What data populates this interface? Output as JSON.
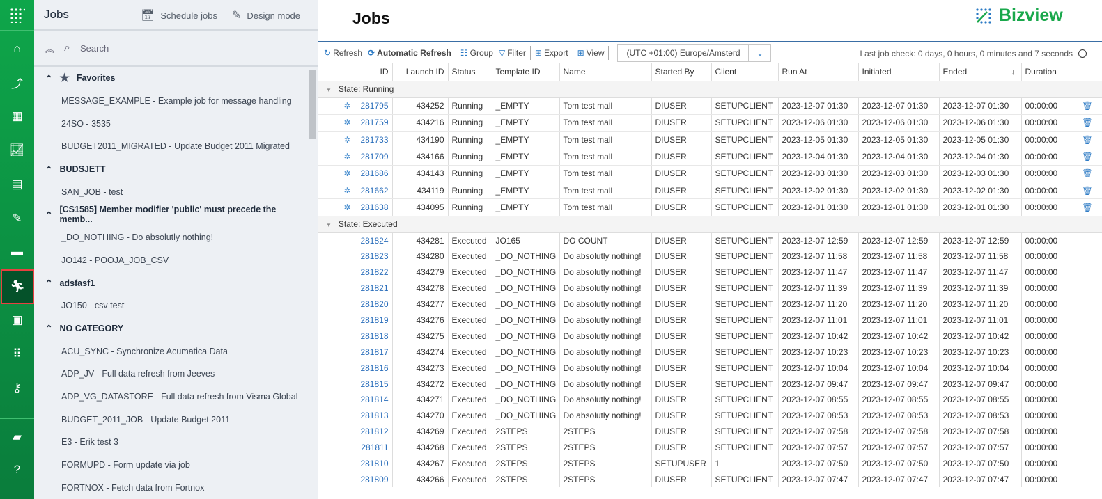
{
  "rail": {
    "items": [
      "home-icon",
      "flow-icon",
      "dashboard-icon",
      "chart-icon",
      "document-icon",
      "form-edit-icon",
      "chat-icon",
      "jobs-runner-icon",
      "contacts-icon",
      "apps-icon",
      "key-icon",
      "folder-icon",
      "help-icon"
    ],
    "active": "jobs-runner-icon"
  },
  "sidebar": {
    "title": "Jobs",
    "schedule_jobs": "Schedule jobs",
    "design_mode": "Design mode",
    "search_placeholder": "Search",
    "tree": [
      {
        "type": "cat",
        "label": "Favorites",
        "star": true
      },
      {
        "type": "item",
        "label": "MESSAGE_EXAMPLE - Example job for message handling"
      },
      {
        "type": "item",
        "label": "24SO - 3535"
      },
      {
        "type": "item",
        "label": "BUDGET2011_MIGRATED - Update Budget 2011 Migrated"
      },
      {
        "type": "cat",
        "label": "BUDSJETT"
      },
      {
        "type": "item",
        "label": "SAN_JOB - test"
      },
      {
        "type": "cat",
        "label": "[CS1585] Member modifier 'public' must precede the memb..."
      },
      {
        "type": "item",
        "label": "_DO_NOTHING - Do absolutly nothing!"
      },
      {
        "type": "item",
        "label": "JO142 - POOJA_JOB_CSV"
      },
      {
        "type": "cat",
        "label": "adsfasf1"
      },
      {
        "type": "item",
        "label": "JO150 - csv test"
      },
      {
        "type": "cat",
        "label": "NO CATEGORY"
      },
      {
        "type": "item",
        "label": "ACU_SYNC - Synchronize Acumatica Data"
      },
      {
        "type": "item",
        "label": "ADP_JV - Full data refresh from Jeeves"
      },
      {
        "type": "item",
        "label": "ADP_VG_DATASTORE - Full data refresh from Visma Global"
      },
      {
        "type": "item",
        "label": "BUDGET_2011_JOB - Update Budget 2011"
      },
      {
        "type": "item",
        "label": "E3 - Erik test 3"
      },
      {
        "type": "item",
        "label": "FORMUPD - Form update via job"
      },
      {
        "type": "item",
        "label": "FORTNOX - Fetch data from Fortnox"
      }
    ]
  },
  "main": {
    "title": "Jobs",
    "logo": "Bizview",
    "brand_color": "#1aa84c",
    "toolbar": {
      "refresh": "Refresh",
      "auto_refresh": "Automatic Refresh",
      "group": "Group",
      "filter": "Filter",
      "export": "Export",
      "view": "View",
      "timezone": "(UTC +01:00) Europe/Amsterd"
    },
    "last_check": "Last job check: 0 days, 0 hours, 0 minutes and 7 seconds",
    "columns": [
      "",
      "ID",
      "Launch ID",
      "Status",
      "Template ID",
      "Name",
      "Started By",
      "Client",
      "Run At",
      "Initiated",
      "Ended",
      "Duration",
      ""
    ],
    "groups": [
      {
        "label": "State: Running",
        "rows": [
          [
            "281795",
            "434252",
            "Running",
            "_EMPTY",
            "Tom test mall",
            "DIUSER",
            "SETUPCLIENT",
            "2023-12-07 01:30",
            "2023-12-07 01:30",
            "2023-12-07 01:30",
            "00:00:00"
          ],
          [
            "281759",
            "434216",
            "Running",
            "_EMPTY",
            "Tom test mall",
            "DIUSER",
            "SETUPCLIENT",
            "2023-12-06 01:30",
            "2023-12-06 01:30",
            "2023-12-06 01:30",
            "00:00:00"
          ],
          [
            "281733",
            "434190",
            "Running",
            "_EMPTY",
            "Tom test mall",
            "DIUSER",
            "SETUPCLIENT",
            "2023-12-05 01:30",
            "2023-12-05 01:30",
            "2023-12-05 01:30",
            "00:00:00"
          ],
          [
            "281709",
            "434166",
            "Running",
            "_EMPTY",
            "Tom test mall",
            "DIUSER",
            "SETUPCLIENT",
            "2023-12-04 01:30",
            "2023-12-04 01:30",
            "2023-12-04 01:30",
            "00:00:00"
          ],
          [
            "281686",
            "434143",
            "Running",
            "_EMPTY",
            "Tom test mall",
            "DIUSER",
            "SETUPCLIENT",
            "2023-12-03 01:30",
            "2023-12-03 01:30",
            "2023-12-03 01:30",
            "00:00:00"
          ],
          [
            "281662",
            "434119",
            "Running",
            "_EMPTY",
            "Tom test mall",
            "DIUSER",
            "SETUPCLIENT",
            "2023-12-02 01:30",
            "2023-12-02 01:30",
            "2023-12-02 01:30",
            "00:00:00"
          ],
          [
            "281638",
            "434095",
            "Running",
            "_EMPTY",
            "Tom test mall",
            "DIUSER",
            "SETUPCLIENT",
            "2023-12-01 01:30",
            "2023-12-01 01:30",
            "2023-12-01 01:30",
            "00:00:00"
          ]
        ]
      },
      {
        "label": "State: Executed",
        "rows": [
          [
            "281824",
            "434281",
            "Executed",
            "JO165",
            "DO COUNT",
            "DIUSER",
            "SETUPCLIENT",
            "2023-12-07 12:59",
            "2023-12-07 12:59",
            "2023-12-07 12:59",
            "00:00:00"
          ],
          [
            "281823",
            "434280",
            "Executed",
            "_DO_NOTHING",
            "Do absolutly nothing!",
            "DIUSER",
            "SETUPCLIENT",
            "2023-12-07 11:58",
            "2023-12-07 11:58",
            "2023-12-07 11:58",
            "00:00:00"
          ],
          [
            "281822",
            "434279",
            "Executed",
            "_DO_NOTHING",
            "Do absolutly nothing!",
            "DIUSER",
            "SETUPCLIENT",
            "2023-12-07 11:47",
            "2023-12-07 11:47",
            "2023-12-07 11:47",
            "00:00:00"
          ],
          [
            "281821",
            "434278",
            "Executed",
            "_DO_NOTHING",
            "Do absolutly nothing!",
            "DIUSER",
            "SETUPCLIENT",
            "2023-12-07 11:39",
            "2023-12-07 11:39",
            "2023-12-07 11:39",
            "00:00:00"
          ],
          [
            "281820",
            "434277",
            "Executed",
            "_DO_NOTHING",
            "Do absolutly nothing!",
            "DIUSER",
            "SETUPCLIENT",
            "2023-12-07 11:20",
            "2023-12-07 11:20",
            "2023-12-07 11:20",
            "00:00:00"
          ],
          [
            "281819",
            "434276",
            "Executed",
            "_DO_NOTHING",
            "Do absolutly nothing!",
            "DIUSER",
            "SETUPCLIENT",
            "2023-12-07 11:01",
            "2023-12-07 11:01",
            "2023-12-07 11:01",
            "00:00:00"
          ],
          [
            "281818",
            "434275",
            "Executed",
            "_DO_NOTHING",
            "Do absolutly nothing!",
            "DIUSER",
            "SETUPCLIENT",
            "2023-12-07 10:42",
            "2023-12-07 10:42",
            "2023-12-07 10:42",
            "00:00:00"
          ],
          [
            "281817",
            "434274",
            "Executed",
            "_DO_NOTHING",
            "Do absolutly nothing!",
            "DIUSER",
            "SETUPCLIENT",
            "2023-12-07 10:23",
            "2023-12-07 10:23",
            "2023-12-07 10:23",
            "00:00:00"
          ],
          [
            "281816",
            "434273",
            "Executed",
            "_DO_NOTHING",
            "Do absolutly nothing!",
            "DIUSER",
            "SETUPCLIENT",
            "2023-12-07 10:04",
            "2023-12-07 10:04",
            "2023-12-07 10:04",
            "00:00:00"
          ],
          [
            "281815",
            "434272",
            "Executed",
            "_DO_NOTHING",
            "Do absolutly nothing!",
            "DIUSER",
            "SETUPCLIENT",
            "2023-12-07 09:47",
            "2023-12-07 09:47",
            "2023-12-07 09:47",
            "00:00:00"
          ],
          [
            "281814",
            "434271",
            "Executed",
            "_DO_NOTHING",
            "Do absolutly nothing!",
            "DIUSER",
            "SETUPCLIENT",
            "2023-12-07 08:55",
            "2023-12-07 08:55",
            "2023-12-07 08:55",
            "00:00:00"
          ],
          [
            "281813",
            "434270",
            "Executed",
            "_DO_NOTHING",
            "Do absolutly nothing!",
            "DIUSER",
            "SETUPCLIENT",
            "2023-12-07 08:53",
            "2023-12-07 08:53",
            "2023-12-07 08:53",
            "00:00:00"
          ],
          [
            "281812",
            "434269",
            "Executed",
            "2STEPS",
            "2STEPS",
            "DIUSER",
            "SETUPCLIENT",
            "2023-12-07 07:58",
            "2023-12-07 07:58",
            "2023-12-07 07:58",
            "00:00:00"
          ],
          [
            "281811",
            "434268",
            "Executed",
            "2STEPS",
            "2STEPS",
            "DIUSER",
            "SETUPCLIENT",
            "2023-12-07 07:57",
            "2023-12-07 07:57",
            "2023-12-07 07:57",
            "00:00:00"
          ],
          [
            "281810",
            "434267",
            "Executed",
            "2STEPS",
            "2STEPS",
            "SETUPUSER",
            "1",
            "2023-12-07 07:50",
            "2023-12-07 07:50",
            "2023-12-07 07:50",
            "00:00:00"
          ],
          [
            "281809",
            "434266",
            "Executed",
            "2STEPS",
            "2STEPS",
            "DIUSER",
            "SETUPCLIENT",
            "2023-12-07 07:47",
            "2023-12-07 07:47",
            "2023-12-07 07:47",
            "00:00:00"
          ]
        ]
      }
    ]
  }
}
